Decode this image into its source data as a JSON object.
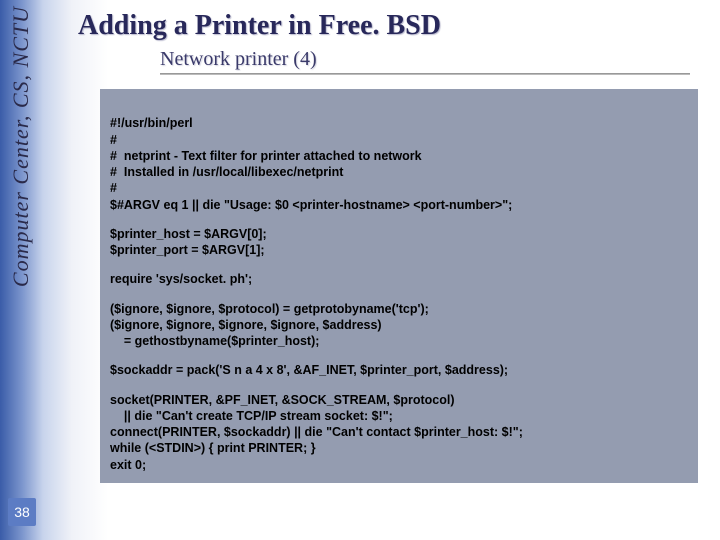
{
  "sidebar": {
    "label": "Computer Center, CS, NCTU"
  },
  "page": {
    "number": "38"
  },
  "slide": {
    "title": "Adding a Printer in Free. BSD",
    "subtitle": "Network printer (4)"
  },
  "code": {
    "b1": "#!/usr/bin/perl\n#\n#  netprint - Text filter for printer attached to network\n#  Installed in /usr/local/libexec/netprint\n#\n$#ARGV eq 1 || die \"Usage: $0 <printer-hostname> <port-number>\";",
    "b2": "$printer_host = $ARGV[0];\n$printer_port = $ARGV[1];",
    "b3": "require 'sys/socket. ph';",
    "b4": "($ignore, $ignore, $protocol) = getprotobyname('tcp');\n($ignore, $ignore, $ignore, $ignore, $address)\n    = gethostbyname($printer_host);",
    "b5": "$sockaddr = pack('S n a 4 x 8', &AF_INET, $printer_port, $address);",
    "b6": "socket(PRINTER, &PF_INET, &SOCK_STREAM, $protocol)\n    || die \"Can't create TCP/IP stream socket: $!\";\nconnect(PRINTER, $sockaddr) || die \"Can't contact $printer_host: $!\";\nwhile (<STDIN>) { print PRINTER; }\nexit 0;"
  }
}
